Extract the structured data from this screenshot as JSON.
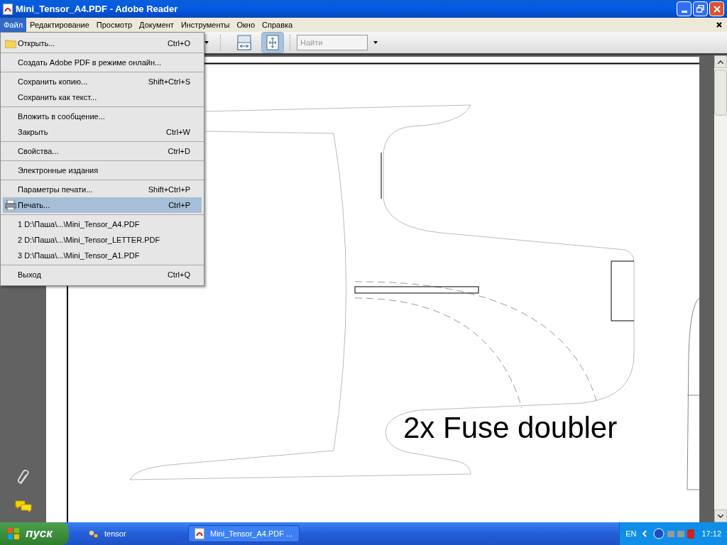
{
  "window": {
    "title": "Mini_Tensor_A4.PDF - Adobe Reader"
  },
  "menu_bar": [
    {
      "label": "Файл",
      "selected": true
    },
    {
      "label": "Редактирование",
      "selected": false
    },
    {
      "label": "Просмотр",
      "selected": false
    },
    {
      "label": "Документ",
      "selected": false
    },
    {
      "label": "Инструменты",
      "selected": false
    },
    {
      "label": "Окно",
      "selected": false
    },
    {
      "label": "Справка",
      "selected": false
    }
  ],
  "file_menu": [
    [
      {
        "label": "Открыть...",
        "shortcut": "Ctrl+O",
        "kind": "open",
        "selected": false
      }
    ],
    [
      {
        "label": "Создать Adobe PDF в режиме онлайн...",
        "kind": "plain",
        "selected": false
      }
    ],
    [
      {
        "label": "Сохранить копию...",
        "shortcut": "Shift+Ctrl+S",
        "kind": "plain",
        "selected": false
      },
      {
        "label": "Сохранить как текст...",
        "kind": "plain",
        "selected": false
      }
    ],
    [
      {
        "label": "Вложить в сообщение...",
        "kind": "plain",
        "selected": false
      },
      {
        "label": "Закрыть",
        "shortcut": "Ctrl+W",
        "kind": "plain",
        "selected": false
      }
    ],
    [
      {
        "label": "Свойства...",
        "shortcut": "Ctrl+D",
        "kind": "plain",
        "selected": false
      }
    ],
    [
      {
        "label": "Электронные издания",
        "kind": "plain",
        "selected": false
      }
    ],
    [
      {
        "label": "Параметры печати...",
        "shortcut": "Shift+Ctrl+P",
        "kind": "plain",
        "selected": false
      },
      {
        "label": "Печать...",
        "shortcut": "Ctrl+P",
        "kind": "print",
        "selected": true
      }
    ],
    [
      {
        "label": "1 D:\\Паша\\...\\Mini_Tensor_A4.PDF",
        "kind": "plain",
        "selected": false
      },
      {
        "label": "2 D:\\Паша\\...\\Mini_Tensor_LETTER.PDF",
        "kind": "plain",
        "selected": false
      },
      {
        "label": "3 D:\\Паша\\...\\Mini_Tensor_A1.PDF",
        "kind": "plain",
        "selected": false
      }
    ],
    [
      {
        "label": "Выход",
        "shortcut": "Ctrl+Q",
        "kind": "plain",
        "selected": false
      }
    ]
  ],
  "toolbar": {
    "buttons": [
      {
        "kind": "fit-width",
        "selected": false
      },
      {
        "kind": "fit-page",
        "selected": true
      }
    ],
    "search": {
      "placeholder": "Найти"
    }
  },
  "document": {
    "label": "2x Fuse doubler"
  },
  "taskbar": {
    "start": "пуск",
    "tasks": [
      {
        "label": "tensor",
        "kind": "folder",
        "selected": false
      },
      {
        "label": "Mini_Tensor_A4.PDF ...",
        "kind": "pdf",
        "selected": false
      }
    ],
    "language": "EN",
    "clock": "17:12"
  }
}
